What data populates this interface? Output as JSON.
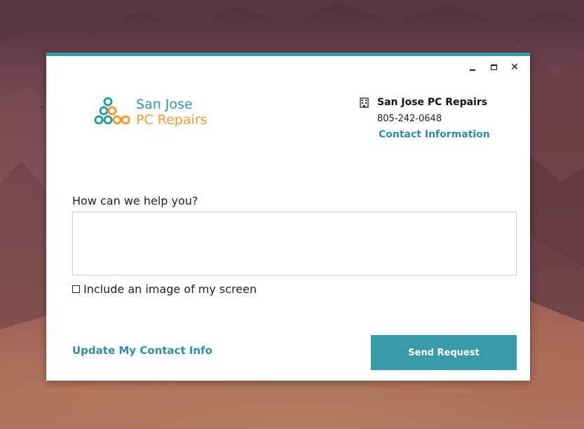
{
  "window": {
    "controls": {
      "minimize_icon": "minimize-icon",
      "maximize_icon": "maximize-icon",
      "close_icon": "close-icon",
      "close_glyph": "✕"
    },
    "accent_color": "#3a9aa8"
  },
  "logo": {
    "line1": "San Jose",
    "line2": "PC Repairs",
    "color_primary": "#2a9d9f",
    "color_secondary": "#f39a2f"
  },
  "company": {
    "icon": "building-icon",
    "name": "San Jose PC Repairs",
    "phone": "805-242-0648",
    "contact_link": "Contact Information"
  },
  "form": {
    "help_label": "How can we help you?",
    "help_value": "",
    "include_screen_label": "Include an image of my screen",
    "include_screen_checked": false
  },
  "footer": {
    "update_link": "Update My Contact Info",
    "send_button": "Send Request"
  }
}
